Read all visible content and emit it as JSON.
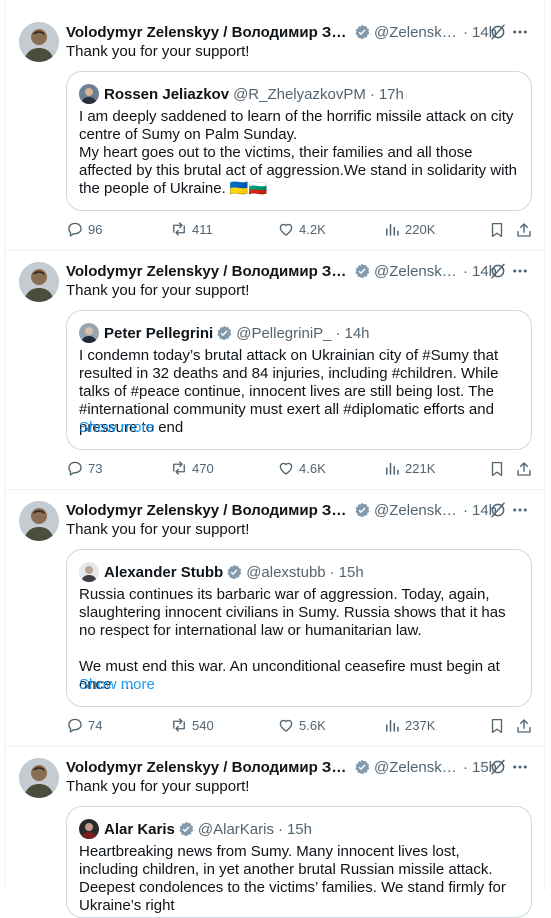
{
  "tweets": [
    {
      "author": "Volodymyr Zelenskyy / Володимир Зеленський",
      "handle": "@ZelenskyyUa",
      "time": "14h",
      "text": "Thank you for your support!",
      "quote": {
        "author": "Rossen Jeliazkov",
        "handle": "@R_ZhelyazkovPM",
        "time": "17h",
        "verified": false,
        "text": "I am deeply saddened to learn of the horrific missile attack on city centre of Sumy on Palm Sunday.\nMy heart goes out to the victims, their families and all those affected by this brutal act of aggression.We stand in solidarity with the people of Ukraine. 🇺🇦🇧🇬",
        "show_more": ""
      },
      "stats": {
        "replies": "96",
        "reposts": "411",
        "likes": "4.2K",
        "views": "220K"
      }
    },
    {
      "author": "Volodymyr Zelenskyy / Володимир Зеленський",
      "handle": "@ZelenskyyUa",
      "time": "14h",
      "text": "Thank you for your support!",
      "quote": {
        "author": "Peter Pellegrini",
        "handle": "@PellegriniP_",
        "time": "14h",
        "verified": true,
        "text": "I condemn today’s brutal attack on Ukrainian city of #Sumy that resulted in 32 deaths and 84 injuries, including #children. While talks of #peace continue, innocent lives are still being lost. The #international community must exert all #diplomatic efforts and pressure to end",
        "show_more": "Show more"
      },
      "stats": {
        "replies": "73",
        "reposts": "470",
        "likes": "4.6K",
        "views": "221K"
      }
    },
    {
      "author": "Volodymyr Zelenskyy / Володимир Зеленський",
      "handle": "@ZelenskyyUa",
      "time": "14h",
      "text": "Thank you for your support!",
      "quote": {
        "author": "Alexander Stubb",
        "handle": "@alexstubb",
        "time": "15h",
        "verified": true,
        "text": "Russia continues its barbaric war of aggression. Today, again, slaughtering innocent civilians in Sumy. Russia shows that it has no respect for international law or humanitarian law.\n\nWe must end this war. An unconditional ceasefire must begin at once. …",
        "show_more": "Show more"
      },
      "stats": {
        "replies": "74",
        "reposts": "540",
        "likes": "5.6K",
        "views": "237K"
      }
    },
    {
      "author": "Volodymyr Zelenskyy / Володимир Зеленський",
      "handle": "@ZelenskyyUa",
      "time": "15h",
      "text": "Thank you for your support!",
      "quote": {
        "author": "Alar Karis",
        "handle": "@AlarKaris",
        "time": "15h",
        "verified": true,
        "text": "Heartbreaking news from Sumy. Many innocent lives lost, including children, in yet another brutal Russian missile attack. Deepest condolences to the victims’ families. We stand firmly for Ukraine’s right",
        "show_more": ""
      },
      "stats": {
        "replies": "",
        "reposts": "",
        "likes": "",
        "views": ""
      }
    }
  ],
  "colors": {
    "accent": "#1d9bf0",
    "muted": "#536471",
    "border": "#cfd9de",
    "verified": "#829aab"
  },
  "icons": [
    "verified-badge-icon",
    "grok-icon",
    "more-icon",
    "reply-icon",
    "repost-icon",
    "like-icon",
    "views-icon",
    "bookmark-icon",
    "share-icon"
  ]
}
